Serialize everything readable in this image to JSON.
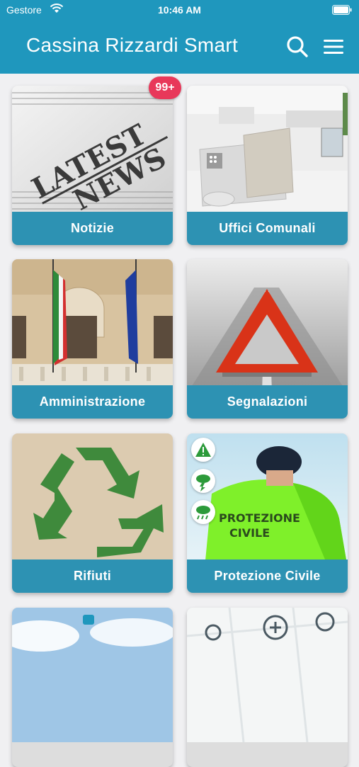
{
  "status_bar": {
    "carrier": "Gestore",
    "time": "10:46 AM"
  },
  "header": {
    "title": "Cassina Rizzardi Smart",
    "search_icon": "search-icon",
    "menu_icon": "hamburger-menu-icon"
  },
  "tiles": [
    {
      "label": "Notizie",
      "badge": "99+",
      "image": "latest-news-newspaper"
    },
    {
      "label": "Uffici Comunali",
      "image": "office-desk"
    },
    {
      "label": "Amministrazione",
      "image": "italian-eu-flags-building"
    },
    {
      "label": "Segnalazioni",
      "image": "warning-triangle-road"
    },
    {
      "label": "Rifiuti",
      "image": "recycle-symbol"
    },
    {
      "label": "Protezione Civile",
      "image": "civil-protection-volunteer",
      "alert_icons": [
        "warning-icon",
        "storm-icon",
        "rain-icon"
      ]
    },
    {
      "label": "",
      "image": "sky-clouds"
    },
    {
      "label": "",
      "image": "map-pins"
    }
  ],
  "colors": {
    "header": "#1f97bd",
    "tile_label_bg": "#2d92b3",
    "badge": "#e8385a"
  }
}
